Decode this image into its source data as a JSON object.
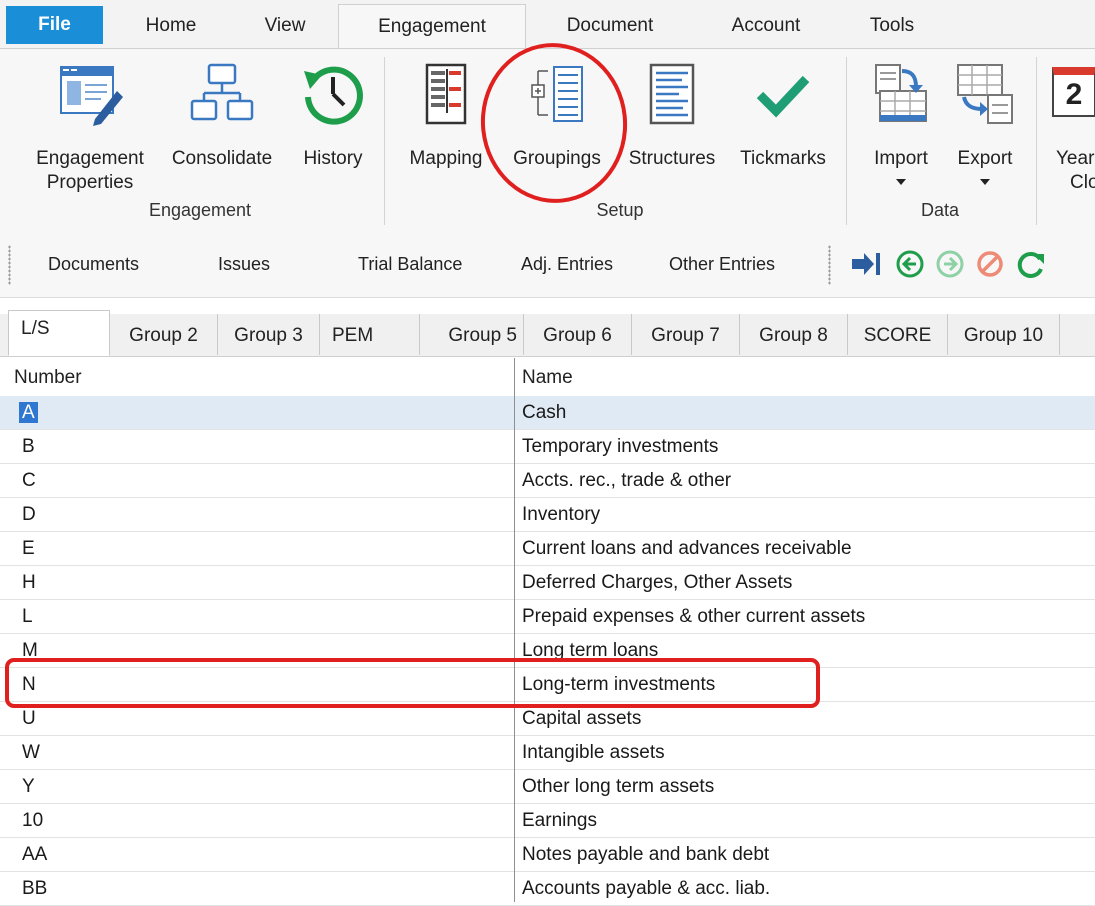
{
  "menu": {
    "tabs": [
      "File",
      "Home",
      "View",
      "Engagement",
      "Document",
      "Account",
      "Tools"
    ],
    "active": "Engagement"
  },
  "ribbon": {
    "engagement_group": {
      "label": "Engagement",
      "buttons": [
        {
          "line1": "Engagement",
          "line2": "Properties",
          "icon": "engagement-properties-icon"
        },
        {
          "line1": "Consolidate",
          "line2": "",
          "icon": "consolidate-icon"
        },
        {
          "line1": "History",
          "line2": "",
          "icon": "history-icon"
        }
      ]
    },
    "setup_group": {
      "label": "Setup",
      "buttons": [
        {
          "line1": "Mapping",
          "icon": "mapping-icon"
        },
        {
          "line1": "Groupings",
          "icon": "groupings-icon"
        },
        {
          "line1": "Structures",
          "icon": "structures-icon"
        },
        {
          "line1": "Tickmarks",
          "icon": "tickmarks-icon"
        }
      ]
    },
    "data_group": {
      "label": "Data",
      "buttons": [
        {
          "line1": "Import",
          "icon": "import-icon"
        },
        {
          "line1": "Export",
          "icon": "export-icon"
        }
      ]
    },
    "partial": {
      "line1": "Year",
      "line2": "Clo",
      "icon_text": "2"
    }
  },
  "toolbar2": {
    "items": [
      "Documents",
      "Issues",
      "Trial Balance",
      "Adj. Entries",
      "Other Entries"
    ],
    "nav_icons": [
      "jump-to-icon",
      "back-arrow-icon",
      "forward-arrow-icon",
      "cancel-icon",
      "refresh-icon"
    ]
  },
  "group_tabs": [
    "L/S",
    "Group 2",
    "Group 3",
    "PEM",
    "Group 5",
    "Group 6",
    "Group 7",
    "Group 8",
    "SCORE",
    "Group 10"
  ],
  "grid": {
    "headers": {
      "number": "Number",
      "name": "Name"
    },
    "rows": [
      {
        "number": "A",
        "name": "Cash"
      },
      {
        "number": "B",
        "name": "Temporary investments"
      },
      {
        "number": "C",
        "name": "Accts. rec., trade & other"
      },
      {
        "number": "D",
        "name": "Inventory"
      },
      {
        "number": "E",
        "name": "Current loans and advances receivable"
      },
      {
        "number": "H",
        "name": "Deferred Charges, Other Assets"
      },
      {
        "number": "L",
        "name": "Prepaid expenses & other current assets"
      },
      {
        "number": "M",
        "name": "Long term loans"
      },
      {
        "number": "N",
        "name": "Long-term investments"
      },
      {
        "number": "U",
        "name": "Capital assets"
      },
      {
        "number": "W",
        "name": "Intangible assets"
      },
      {
        "number": "Y",
        "name": "Other long term assets"
      },
      {
        "number": "10",
        "name": "Earnings"
      },
      {
        "number": "AA",
        "name": "Notes payable and bank debt"
      },
      {
        "number": "BB",
        "name": "Accounts payable & acc. liab."
      }
    ]
  },
  "colors": {
    "accent": "#1b8ed8",
    "selection": "#dfeaf5",
    "annotation": "#e01f1f",
    "nav_green": "#1e9e4a"
  }
}
